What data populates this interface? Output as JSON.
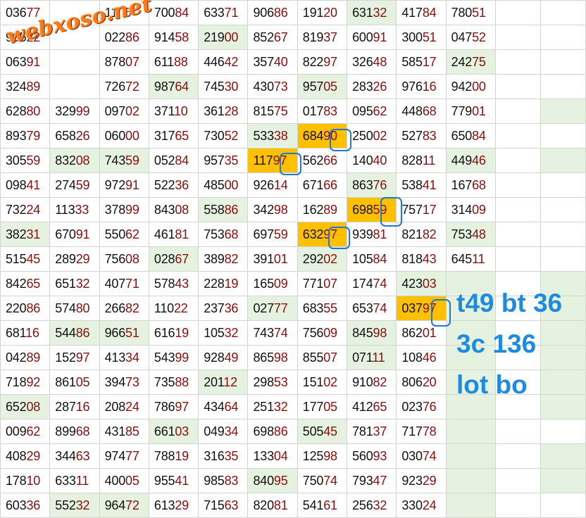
{
  "watermark": "webxoso.net",
  "rows": [
    [
      "03677",
      "",
      "11..6",
      "70084",
      "63371",
      "90686",
      "19120",
      "63132",
      "41784",
      "78051"
    ],
    [
      "90522",
      "",
      "02286",
      "91458",
      "21900",
      "85267",
      "81937",
      "60091",
      "30051",
      "04752"
    ],
    [
      "06391",
      "",
      "87807",
      "61188",
      "44642",
      "35740",
      "82297",
      "32648",
      "58517",
      "24275"
    ],
    [
      "32489",
      "",
      "72672",
      "98764",
      "74530",
      "43073",
      "95705",
      "28326",
      "97616",
      "94200"
    ],
    [
      "62880",
      "32999",
      "09702",
      "37110",
      "36128",
      "81575",
      "01783",
      "09562",
      "44868",
      "77901"
    ],
    [
      "89379",
      "65826",
      "06000",
      "31765",
      "73052",
      "53338",
      "68490",
      "25002",
      "52783",
      "65084"
    ],
    [
      "30559",
      "83208",
      "74359",
      "05284",
      "95735",
      "11797",
      "56266",
      "14040",
      "82811",
      "44946"
    ],
    [
      "09841",
      "27459",
      "97291",
      "52236",
      "48500",
      "92614",
      "67166",
      "86376",
      "53841",
      "16768"
    ],
    [
      "73224",
      "11333",
      "37899",
      "84308",
      "55886",
      "34298",
      "16289",
      "69859",
      "75717",
      "31409"
    ],
    [
      "38231",
      "67091",
      "55062",
      "46181",
      "75368",
      "69759",
      "63297",
      "93981",
      "82182",
      "75348"
    ],
    [
      "51545",
      "28929",
      "75608",
      "02867",
      "38982",
      "39101",
      "29202",
      "10584",
      "81843",
      "64511"
    ],
    [
      "84265",
      "65132",
      "40771",
      "57843",
      "22819",
      "16509",
      "77107",
      "17474",
      "42303",
      ""
    ],
    [
      "22086",
      "57480",
      "26682",
      "11022",
      "23736",
      "02777",
      "68355",
      "65374",
      "03797",
      ""
    ],
    [
      "68116",
      "54486",
      "96651",
      "61619",
      "10532",
      "74374",
      "75609",
      "84598",
      "86201",
      ""
    ],
    [
      "04289",
      "15297",
      "41334",
      "54399",
      "92849",
      "86598",
      "85507",
      "07111",
      "10846",
      ""
    ],
    [
      "71892",
      "86105",
      "39473",
      "73588",
      "20112",
      "29853",
      "15102",
      "91082",
      "80620",
      ""
    ],
    [
      "65208",
      "28716",
      "20824",
      "78697",
      "43464",
      "25132",
      "17705",
      "41265",
      "02376",
      ""
    ],
    [
      "00962",
      "89968",
      "43185",
      "66103",
      "04934",
      "69886",
      "50545",
      "78137",
      "71778",
      ""
    ],
    [
      "40829",
      "34463",
      "97477",
      "78819",
      "31635",
      "13304",
      "12598",
      "56093",
      "03074",
      ""
    ],
    [
      "17810",
      "63311",
      "40005",
      "95541",
      "98583",
      "84095",
      "75074",
      "79347",
      "92329",
      ""
    ],
    [
      "60336",
      "55232",
      "96472",
      "61329",
      "71563",
      "82081",
      "54161",
      "25632",
      "33024",
      ""
    ]
  ],
  "notes": [
    "t49 bt 36",
    "3c 136",
    "lot bo"
  ],
  "colors": {
    "green": "#e4f2df",
    "orange": "#ffc000",
    "digits_dark": "#111111",
    "digits_red": "#8b0d0d",
    "note": "#1e8be0"
  }
}
